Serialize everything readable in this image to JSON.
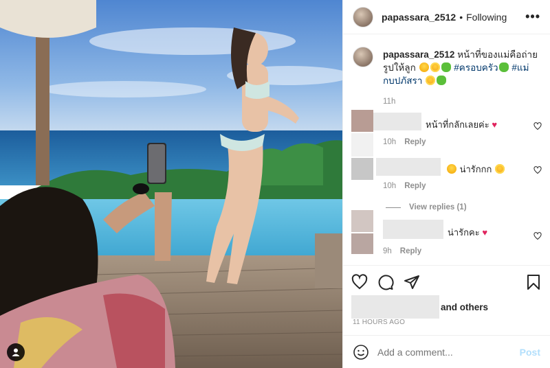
{
  "header": {
    "username": "papassara_2512",
    "separator": "•",
    "follow_status": "Following",
    "more_label": "•••"
  },
  "caption": {
    "username": "papassara_2512",
    "text_1": "หน้าที่ของแม่คือถ่ายรูปให้ลูก",
    "hashtag_1": "#ครอบครัว",
    "hashtag_2": "#แม่กบปภัสรา",
    "time": "11h"
  },
  "comments": [
    {
      "text": "หน้าที่กลักเลยค่ะ",
      "time": "10h",
      "reply": "Reply",
      "emoji": "♥"
    },
    {
      "text": "น่ารักกก",
      "time": "10h",
      "reply": "Reply"
    },
    {
      "text": "น่ารักคะ",
      "time": "9h",
      "reply": "Reply",
      "emoji": "♥"
    }
  ],
  "view_replies": "View replies (1)",
  "likes": {
    "suffix": "and others"
  },
  "timestamp": "11 HOURS AGO",
  "add_comment": {
    "placeholder": "Add a comment...",
    "post_label": "Post"
  },
  "icons": {
    "like": "heart-icon",
    "comment": "comment-icon",
    "share": "share-icon",
    "save": "bookmark-icon",
    "emoji": "smiley-icon",
    "tag": "user-tag-icon"
  },
  "colors": {
    "hashtag": "#00376b",
    "muted": "#8e8e8e",
    "post_button": "#b2dffc",
    "heart": "#e0245e"
  }
}
